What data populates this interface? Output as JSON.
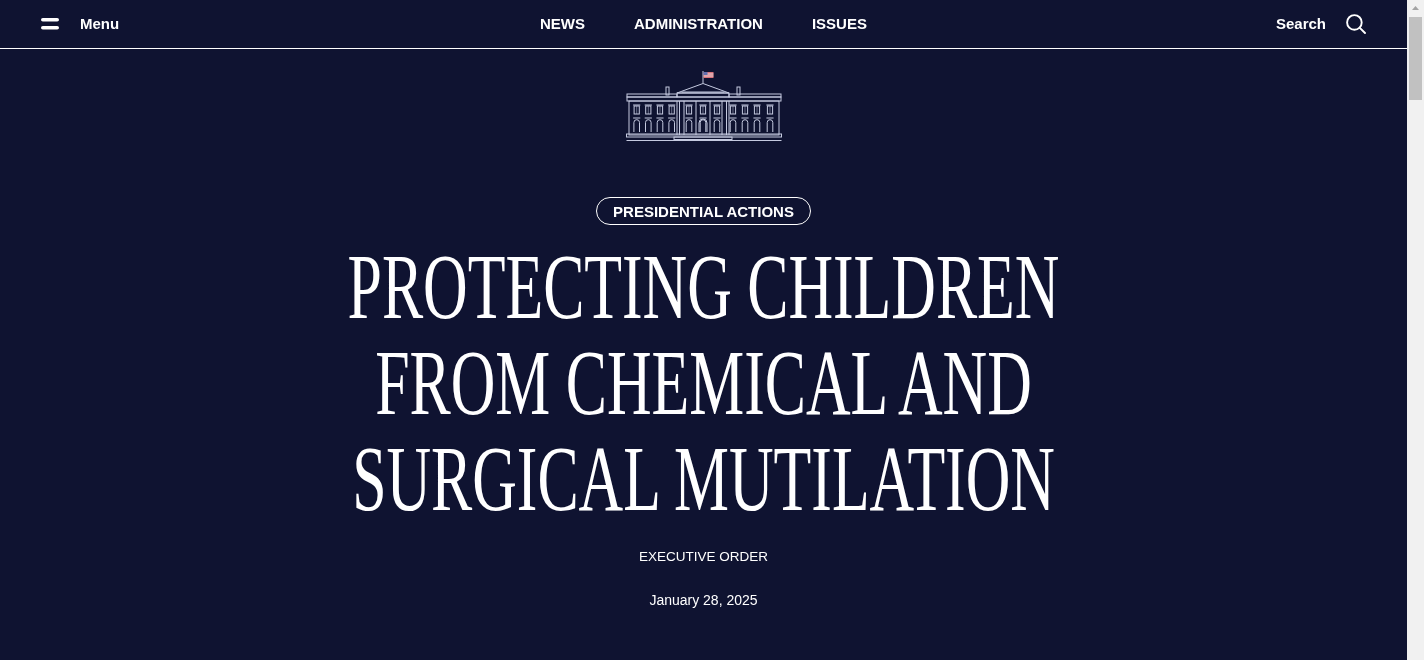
{
  "header": {
    "menu": {
      "label": "Menu"
    },
    "nav": [
      {
        "label": "NEWS"
      },
      {
        "label": "ADMINISTRATION"
      },
      {
        "label": "ISSUES"
      }
    ],
    "search": {
      "label": "Search"
    }
  },
  "article": {
    "category": "PRESIDENTIAL ACTIONS",
    "title": "PROTECTING CHILDREN FROM CHEMICAL AND SURGICAL MUTILATION",
    "type": "EXECUTIVE ORDER",
    "date": "January 28, 2025"
  }
}
